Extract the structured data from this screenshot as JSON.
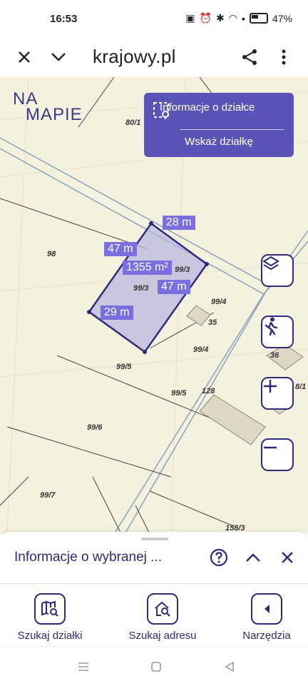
{
  "status": {
    "time": "16:53",
    "battery": "47%"
  },
  "browser": {
    "url": "krajowy.pl"
  },
  "map": {
    "logo_line1": "NA",
    "logo_line2": "MAPIE",
    "info_panel": {
      "title": "Informacje o działce",
      "action": "Wskaż działkę"
    },
    "plot_labels": [
      "80/1",
      "98",
      "99/3",
      "99/3",
      "99/4",
      "35",
      "99/4",
      "36",
      "99/5",
      "99/5",
      "128",
      "99/6",
      "99/7",
      "158/3",
      "8/1"
    ],
    "dimensions": [
      "28 m",
      "47 m",
      "1355 m²",
      "47 m",
      "29 m"
    ],
    "colors": {
      "accent": "#2f2a7a",
      "selection": "#7b6fe0"
    }
  },
  "sheet": {
    "title": "Informacje o wybranej ...",
    "tools": [
      {
        "label": "Szukaj działki",
        "icon": "map-search-icon"
      },
      {
        "label": "Szukaj adresu",
        "icon": "home-search-icon"
      },
      {
        "label": "Narzędzia",
        "icon": "chevron-left-icon"
      }
    ]
  }
}
